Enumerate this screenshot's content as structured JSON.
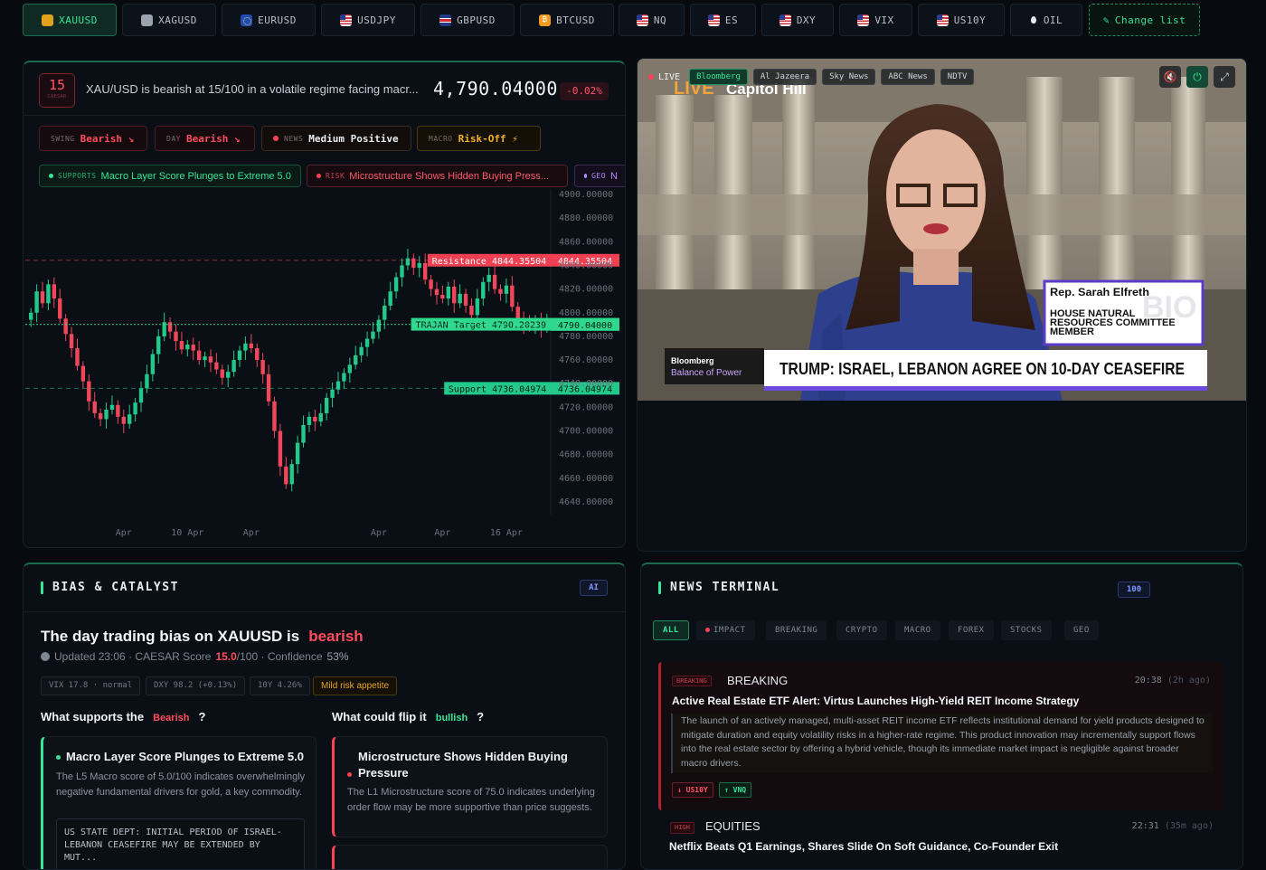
{
  "tickers": [
    {
      "label": "XAUUSD",
      "icon": "gold-bar-icon",
      "active": true
    },
    {
      "label": "XAGUSD",
      "icon": "silver-bar-icon"
    },
    {
      "label": "EURUSD",
      "icon": "eu-flag-icon"
    },
    {
      "label": "USDJPY",
      "icon": "us-flag-icon"
    },
    {
      "label": "GBPUSD",
      "icon": "uk-flag-icon"
    },
    {
      "label": "BTCUSD",
      "icon": "bitcoin-icon"
    },
    {
      "label": "NQ",
      "icon": "us-flag-icon"
    },
    {
      "label": "ES",
      "icon": "us-flag-icon"
    },
    {
      "label": "DXY",
      "icon": "us-flag-icon"
    },
    {
      "label": "VIX",
      "icon": "us-flag-icon"
    },
    {
      "label": "US10Y",
      "icon": "us-flag-icon"
    },
    {
      "label": "OIL",
      "icon": "oil-drop-icon"
    }
  ],
  "change_list_label": "Change list",
  "chart_panel": {
    "score": "15",
    "score_label": "CAESAR",
    "headline": "XAU/USD is bearish at 15/100 in a volatile regime facing macr...",
    "price": "4,790.04000",
    "change": "-0.02%",
    "pills": [
      {
        "key": "SWING",
        "value": "Bearish ↘"
      },
      {
        "key": "DAY",
        "value": "Bearish ↘"
      },
      {
        "key": "NEWS",
        "value": "Medium Positive"
      },
      {
        "key": "MACRO",
        "value": "Risk-Off ⚡"
      }
    ],
    "chips": [
      {
        "key": "SUPPORTS",
        "text": "Macro Layer Score Plunges to Extreme 5.0"
      },
      {
        "key": "RISK",
        "text": "Microstructure Shows Hidden Buying Press..."
      },
      {
        "key": "GEO",
        "text": "N"
      }
    ],
    "colors": {
      "up": "#22c98a",
      "down": "#f0475a",
      "accent": "#35e59a"
    }
  },
  "chart_data": {
    "type": "candlestick",
    "ylim": [
      4640,
      4900
    ],
    "y_ticks": [
      "4900.00000",
      "4880.00000",
      "4860.00000",
      "4840.00000",
      "4820.00000",
      "4800.00000",
      "4780.00000",
      "4760.00000",
      "4740.00000",
      "4720.00000",
      "4700.00000",
      "4680.00000",
      "4660.00000",
      "4640.00000"
    ],
    "x_ticks": [
      {
        "label": "Apr",
        "index": 16
      },
      {
        "label": "10 Apr",
        "index": 27
      },
      {
        "label": "Apr",
        "index": 38
      },
      {
        "label": "Apr",
        "index": 60
      },
      {
        "label": "Apr",
        "index": 71
      },
      {
        "label": "16 Apr",
        "index": 82
      }
    ],
    "close": [
      4800,
      4818,
      4808,
      4824,
      4812,
      4795,
      4782,
      4770,
      4755,
      4742,
      4725,
      4715,
      4710,
      4718,
      4722,
      4712,
      4706,
      4714,
      4724,
      4736,
      4748,
      4765,
      4780,
      4792,
      4784,
      4776,
      4769,
      4773,
      4768,
      4760,
      4763,
      4758,
      4752,
      4745,
      4750,
      4760,
      4768,
      4774,
      4770,
      4760,
      4748,
      4725,
      4700,
      4670,
      4655,
      4672,
      4690,
      4705,
      4712,
      4708,
      4715,
      4728,
      4735,
      4742,
      4749,
      4756,
      4764,
      4771,
      4778,
      4784,
      4794,
      4806,
      4818,
      4830,
      4840,
      4846,
      4838,
      4842,
      4828,
      4820,
      4815,
      4812,
      4822,
      4808,
      4816,
      4806,
      4798,
      4812,
      4826,
      4832,
      4820,
      4816,
      4823,
      4805,
      4795,
      4790,
      4788,
      4794,
      4787,
      4791
    ],
    "levels": [
      {
        "label": "Resistance",
        "value": "4844.35504",
        "y": 4844.35504,
        "kind": "resistance"
      },
      {
        "label": "TRAJAN Target",
        "value": "4790.20239",
        "y": 4790.20239,
        "kind": "target"
      },
      {
        "label": "",
        "value": "4790.04000",
        "y": 4790.04,
        "kind": "current"
      },
      {
        "label": "Support",
        "value": "4736.04974",
        "y": 4736.04974,
        "kind": "support"
      }
    ]
  },
  "video": {
    "live_label": "LIVE",
    "channels": [
      "Bloomberg",
      "Al Jazeera",
      "Sky News",
      "ABC News",
      "NDTV"
    ],
    "active_channel": "Bloomberg",
    "bug_top": "LIVE",
    "bug_location": "Capitol Hill",
    "brand_top": "Bloomberg",
    "brand_bottom": "Balance of Power",
    "headline": "TRUMP: ISRAEL, LEBANON AGREE ON 10-DAY CEASEFIRE",
    "name": "Rep. Sarah Elfreth",
    "role": "HOUSE NATURAL RESOURCES COMMITTEE MEMBER",
    "watermark": "BIO"
  },
  "bias": {
    "section_title": "BIAS & CATALYST",
    "badge": "AI",
    "title_prefix": "The day trading bias on XAUUSD is",
    "bias_word": "bearish",
    "updated_prefix": "Updated 23:06 · CAESAR Score",
    "score": "15.0",
    "score_suffix": "/100 · Confidence",
    "confidence": "53%",
    "tags": [
      "VIX 17.8 · normal",
      "DXY 98.2 (+0.13%)",
      "10Y 4.26%",
      "Mild risk appetite"
    ],
    "supports_prefix": "What supports the",
    "supports_word": "Bearish",
    "flip_prefix": "What could flip it",
    "flip_word": "bullish",
    "qmark": "?",
    "support_card": {
      "title": "Macro Layer Score Plunges to Extreme 5.0",
      "body": "The L5 Macro score of 5.0/100 indicates overwhelmingly negative fundamental drivers for gold, a key commodity.",
      "quote": "US STATE DEPT: INITIAL PERIOD OF ISRAEL-LEBANON CEASEFIRE MAY BE EXTENDED BY MUT..."
    },
    "flip_card": {
      "title": "Microstructure Shows Hidden Buying Pressure",
      "body": "The L1 Microstructure score of 75.0 indicates underlying order flow may be more supportive than price suggests."
    }
  },
  "news": {
    "section_title": "NEWS TERMINAL",
    "count": "100",
    "filters": [
      "ALL",
      "IMPACT",
      "BREAKING",
      "CRYPTO",
      "MACRO",
      "FOREX",
      "STOCKS",
      "GEO"
    ],
    "items": [
      {
        "badge": "BREAKING",
        "category": "BREAKING",
        "time": "20:38",
        "ago": "(2h ago)",
        "title": "Active Real Estate ETF Alert: Virtus Launches High-Yield REIT Income Strategy",
        "body": "The launch of an actively managed, multi-asset REIT income ETF reflects institutional demand for yield products designed to mitigate duration and equity volatility risks in a higher-rate regime. This product innovation may incrementally support flows into the real estate sector by offering a hybrid vehicle, though its immediate market impact is negligible against broader macro drivers.",
        "tags": [
          "↓ US10Y",
          "↑ VNQ"
        ]
      },
      {
        "badge": "HIGH",
        "category": "EQUITIES",
        "time": "22:31",
        "ago": "(35m ago)",
        "title": "Netflix Beats Q1 Earnings, Shares Slide On Soft Guidance, Co-Founder Exit"
      }
    ]
  }
}
